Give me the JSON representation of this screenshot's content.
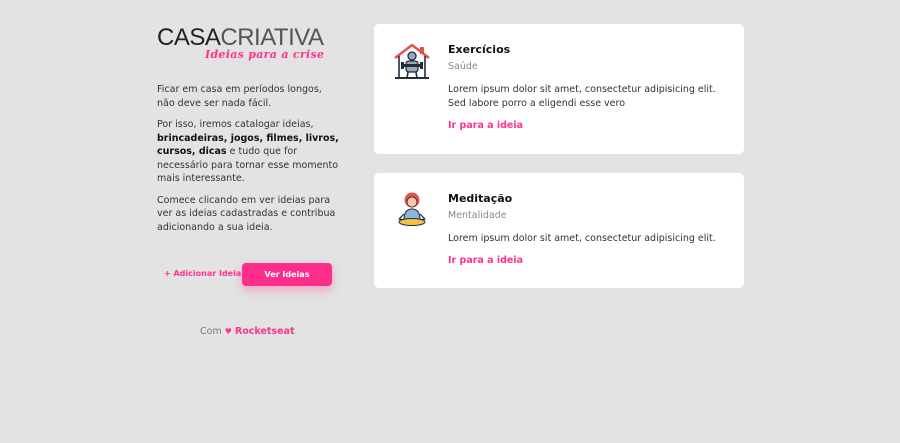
{
  "logo": {
    "word_bold": "CASA",
    "word_light": "CRIATIVA",
    "tagline": "Ideias para a crise"
  },
  "sidebar": {
    "p1": "Ficar em casa em períodos longos, não deve ser nada fácil.",
    "p2_intro": "Por isso, iremos catalogar ideias,",
    "p2_bold": "brincadeiras, jogos, filmes, livros, cursos, dicas",
    "p2_rest": "e tudo que for necessário para tornar esse momento mais interessante.",
    "p3": "Comece clicando em ver ideias para ver as ideias cadastradas e contribua adicionando a sua ideia.",
    "add_link": "+ Adicionar Ideia",
    "view_button": "Ver Ideias"
  },
  "footer": {
    "prefix": "Com",
    "heart": "♥",
    "brand": "Rocketseat"
  },
  "cards": [
    {
      "title": "Exercícios",
      "category": "Saúde",
      "description": "Lorem ipsum dolor sit amet, consectetur adipisicing elit. Sed labore porro a eligendi esse vero",
      "link": "Ir para a ideia",
      "icon": "house-workout-icon"
    },
    {
      "title": "Meditação",
      "category": "Mentalidade",
      "description": "Lorem ipsum dolor sit amet, consectetur adipisicing elit.",
      "link": "Ir para a ideia",
      "icon": "meditation-icon"
    }
  ],
  "colors": {
    "accent": "#ff338b",
    "background": "#e3e3e3",
    "card": "#ffffff"
  }
}
